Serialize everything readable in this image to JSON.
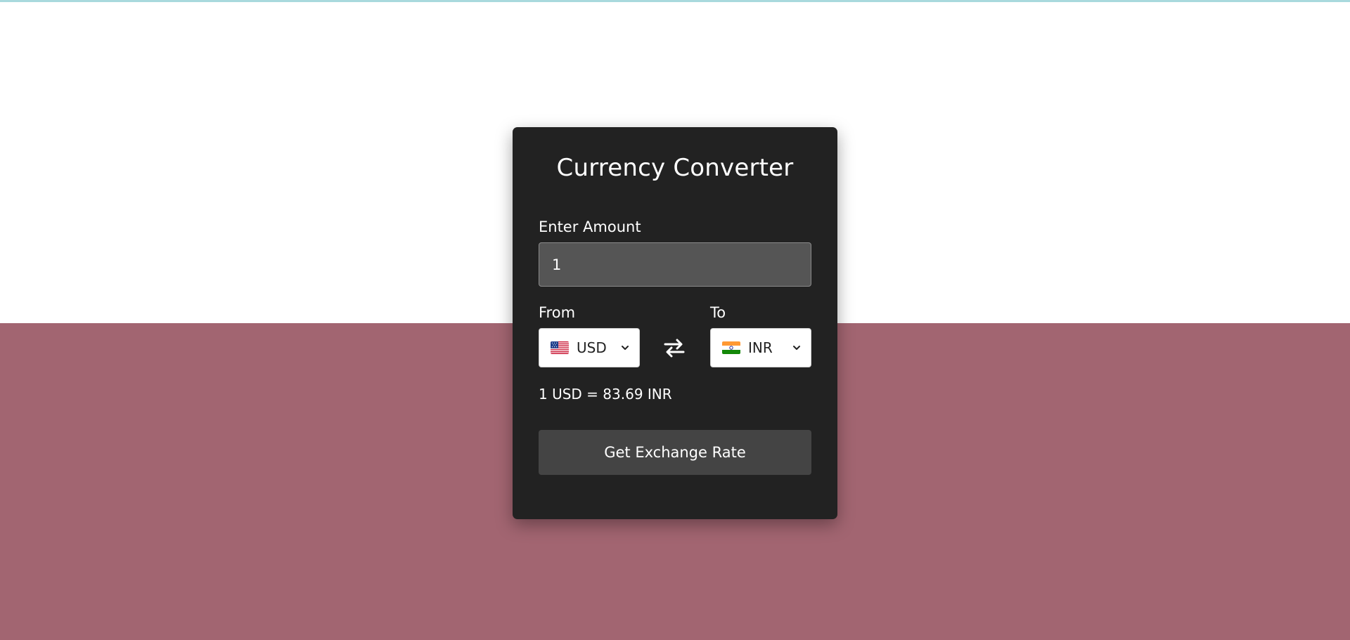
{
  "converter": {
    "title": "Currency Converter",
    "amount_label": "Enter Amount",
    "amount_value": "1",
    "from_label": "From",
    "to_label": "To",
    "from_currency": {
      "code": "USD",
      "flag_icon": "us-flag-icon"
    },
    "to_currency": {
      "code": "INR",
      "flag_icon": "india-flag-icon"
    },
    "rate_text": "1 USD = 83.69 INR",
    "button_label": "Get Exchange Rate"
  },
  "colors": {
    "background_top": "#ffffff",
    "background_bottom": "#a26571",
    "card_background": "#222222",
    "input_background": "#555555",
    "button_background": "#444444",
    "accent_strip": "#a9d9dd"
  }
}
